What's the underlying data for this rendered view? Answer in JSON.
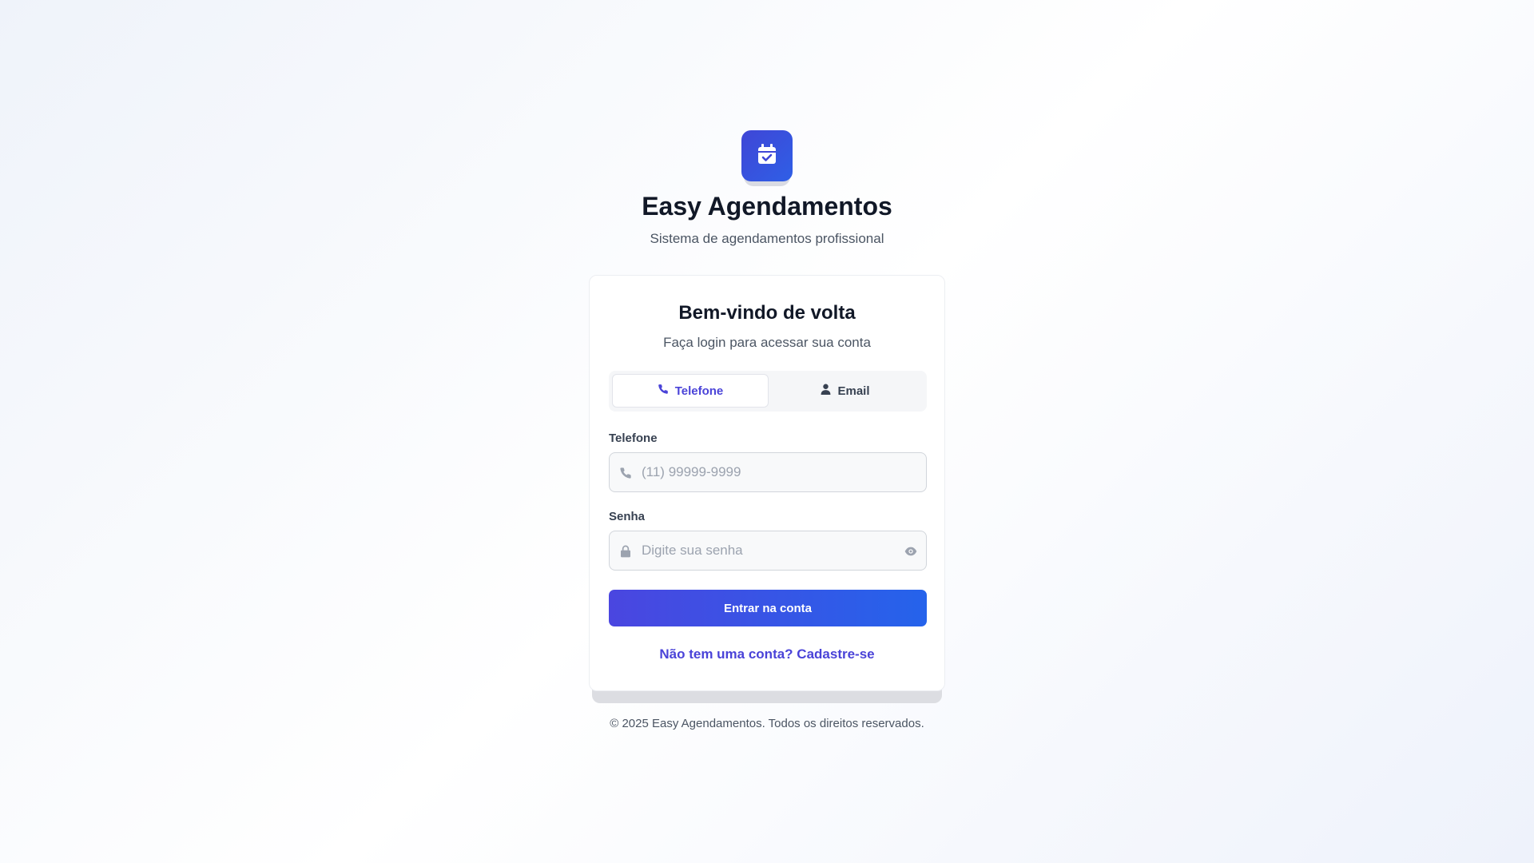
{
  "brand": {
    "logo_icon": "calendar-check-icon",
    "title": "Easy Agendamentos",
    "subtitle": "Sistema de agendamentos profissional"
  },
  "login_card": {
    "title": "Bem-vindo de volta",
    "subtitle": "Faça login para acessar sua conta",
    "tabs": [
      {
        "label": "Telefone",
        "icon": "phone-icon",
        "active": true
      },
      {
        "label": "Email",
        "icon": "user-icon",
        "active": false
      }
    ],
    "phone_field": {
      "label": "Telefone",
      "placeholder": "(11) 99999-9999",
      "value": "",
      "icon": "phone-icon"
    },
    "password_field": {
      "label": "Senha",
      "placeholder": "Digite sua senha",
      "value": "",
      "icon": "lock-icon",
      "toggle_icon": "eye-icon"
    },
    "submit_label": "Entrar na conta",
    "signup_link": "Não tem uma conta? Cadastre-se"
  },
  "footer": {
    "text": "© 2025 Easy Agendamentos. Todos os direitos reservados."
  },
  "colors": {
    "primary": "#4a43d8",
    "primary_gradient_end": "#2563eb",
    "text_dark": "#111827",
    "text_muted": "#4b5563"
  }
}
